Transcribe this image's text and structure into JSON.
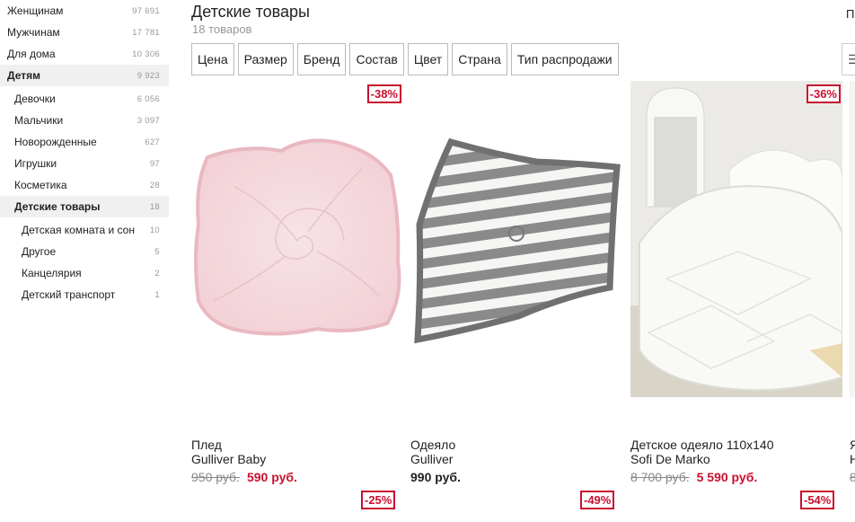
{
  "sidebar": {
    "items": [
      {
        "label": "Женщинам",
        "count": "97 691"
      },
      {
        "label": "Мужчинам",
        "count": "17 781"
      },
      {
        "label": "Для дома",
        "count": "10 306"
      },
      {
        "label": "Детям",
        "count": "9 923"
      },
      {
        "label": "Девочки",
        "count": "6 056"
      },
      {
        "label": "Мальчики",
        "count": "3 097"
      },
      {
        "label": "Новорожденные",
        "count": "627"
      },
      {
        "label": "Игрушки",
        "count": "97"
      },
      {
        "label": "Косметика",
        "count": "28"
      },
      {
        "label": "Детские товары",
        "count": "18"
      },
      {
        "label": "Детская комната и сон",
        "count": "10"
      },
      {
        "label": "Другое",
        "count": "5"
      },
      {
        "label": "Канцелярия",
        "count": "2"
      },
      {
        "label": "Детский транспорт",
        "count": "1"
      }
    ]
  },
  "header": {
    "title": "Детские товары",
    "subtitle": "18 товаров",
    "corner_text": "П"
  },
  "filters": [
    "Цена",
    "Размер",
    "Бренд",
    "Состав",
    "Цвет",
    "Страна",
    "Тип распродажи"
  ],
  "products": [
    {
      "discount": "-38%",
      "name": "Плед",
      "brand": "Gulliver Baby",
      "old_price": "950 руб.",
      "price": "590 руб."
    },
    {
      "discount": "",
      "name": "Одеяло",
      "brand": "Gulliver",
      "old_price": "",
      "price": "990 руб."
    },
    {
      "discount": "-36%",
      "name": "Детское одеяло 110x140",
      "brand": "Sofi De Marko",
      "old_price": "8 700 руб.",
      "price": "5 590 руб."
    },
    {
      "name": "Я",
      "brand": "Н",
      "old_price": "8"
    }
  ],
  "next_row_badges": [
    "-25%",
    "-49%",
    "-54%"
  ],
  "colors": {
    "accent": "#c8102e",
    "muted": "#999999",
    "active_bg": "#f0f0f0"
  }
}
